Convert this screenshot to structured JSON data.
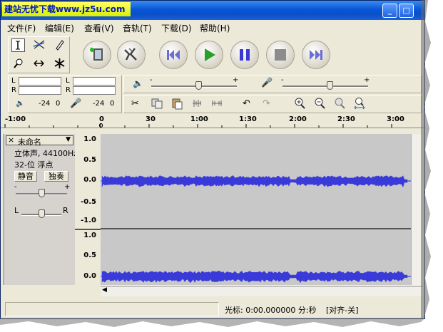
{
  "window": {
    "title_logo": "建站无忧下载www.jz5u.com",
    "min_label": "_",
    "max_label": "□"
  },
  "menu": {
    "items": [
      "文件(F)",
      "编辑(E)",
      "查看(V)",
      "音轨(T)",
      "下载(D)",
      "帮助(H)"
    ]
  },
  "tools": {
    "icons": [
      "select-tool-icon",
      "envelope-tool-icon",
      "draw-tool-icon",
      "zoom-tool-icon",
      "timeshift-tool-icon",
      "multi-tool-icon"
    ]
  },
  "transport": {
    "colors": {
      "skip": "#6c6cd8",
      "play": "#28a028",
      "pause": "#3a3ad0",
      "stop": "#8c8c8c"
    }
  },
  "meters": {
    "play_L": "L",
    "play_R": "R",
    "rec_L": "L",
    "rec_R": "R",
    "scale_db": "-24",
    "scale_zero": "0"
  },
  "mixer": {
    "minus": "-",
    "plus": "+",
    "output_level": 0.55,
    "input_level": 0.55
  },
  "ruler": {
    "labels": [
      "-1:00",
      "0",
      "30",
      "1:00",
      "1:30",
      "2:00",
      "2:30",
      "3:00"
    ]
  },
  "track": {
    "name": "未命名",
    "close": "×",
    "format": "立体声, 44100Hz",
    "bitdepth": "32-位 浮点",
    "mute": "静音",
    "solo": "独奏",
    "gain_minus": "-",
    "gain_plus": "+",
    "pan_left": "L",
    "pan_right": "R",
    "scale_top": [
      "1.0",
      "0.5",
      "0.0",
      "-0.5",
      "-1.0"
    ],
    "scale_bottom": [
      "1.0",
      "0.5",
      "0.0"
    ]
  },
  "status": {
    "cursor_text": "光标: 0:00.000000 分:秒",
    "snap_text": "[对齐-关]"
  }
}
